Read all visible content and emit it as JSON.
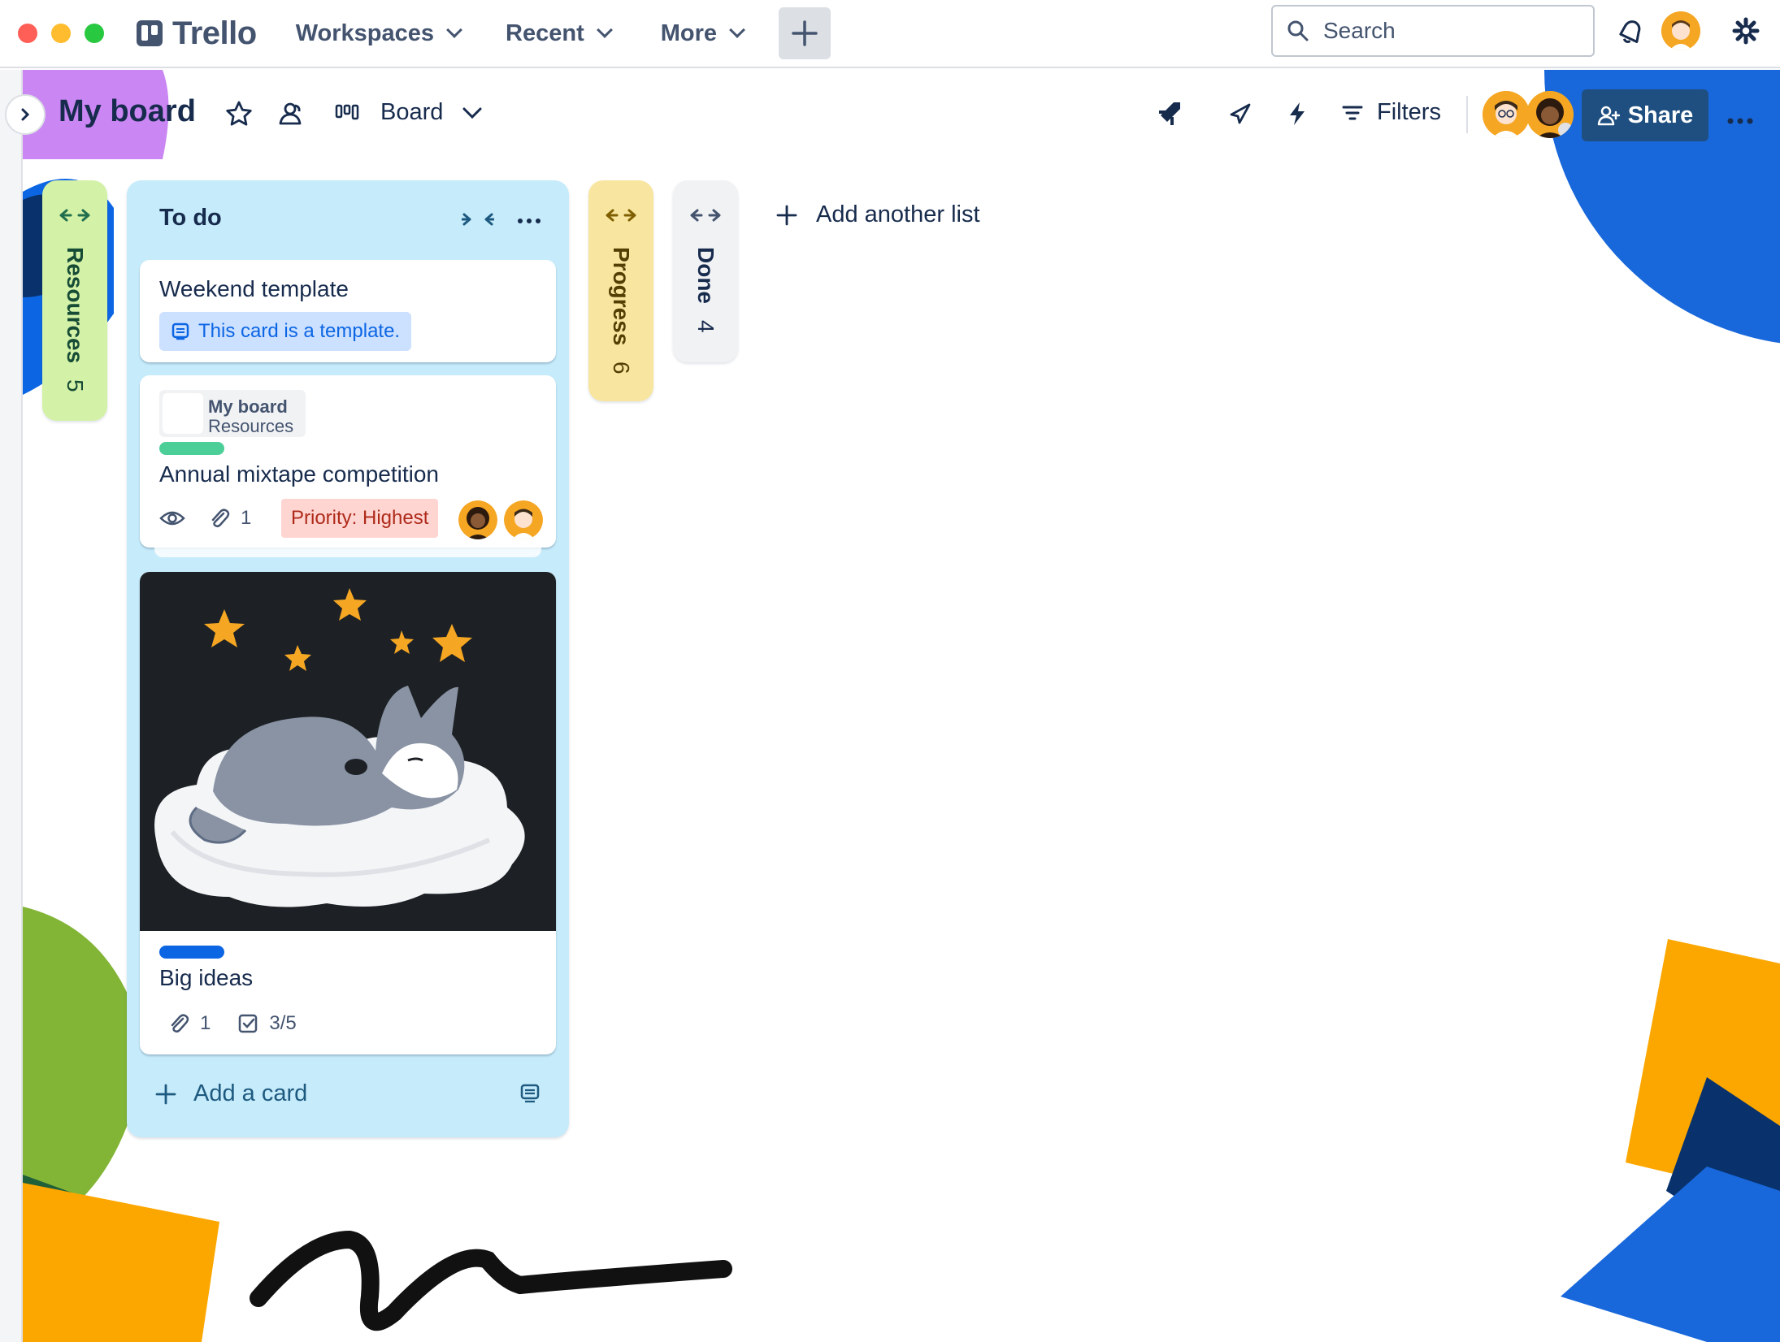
{
  "app": {
    "name": "Trello"
  },
  "topbar": {
    "nav": [
      {
        "label": "Workspaces"
      },
      {
        "label": "Recent"
      },
      {
        "label": "More"
      }
    ],
    "search_placeholder": "Search"
  },
  "board": {
    "title": "My board",
    "view_label": "Board",
    "filters_label": "Filters",
    "share_label": "Share"
  },
  "lists": {
    "resources": {
      "name": "Resources",
      "count": "5",
      "color": "#d3f1a7"
    },
    "todo": {
      "name": "To do",
      "color": "#c6ebfa"
    },
    "progress": {
      "name": "Progress",
      "count": "6",
      "color": "#f8e6a0"
    },
    "done": {
      "name": "Done",
      "count": "4",
      "color": "#f1f2f4"
    }
  },
  "cards": {
    "weekend": {
      "title": "Weekend template",
      "template_badge": "This card is a template."
    },
    "mixtape": {
      "mirror_board": "My board",
      "mirror_list": "Resources",
      "label_color": "#4bce97",
      "title": "Annual mixtape competition",
      "attachments": "1",
      "priority": "Priority: Highest"
    },
    "bigideas": {
      "label_color": "#0c66e4",
      "title": "Big ideas",
      "attachments": "1",
      "checklist": "3/5"
    }
  },
  "add_card_label": "Add a card",
  "add_list_label": "Add another list",
  "colors": {
    "accent": "#0c66e4",
    "share_button": "#1e4f80",
    "avatar_bg": "#f5a623"
  }
}
